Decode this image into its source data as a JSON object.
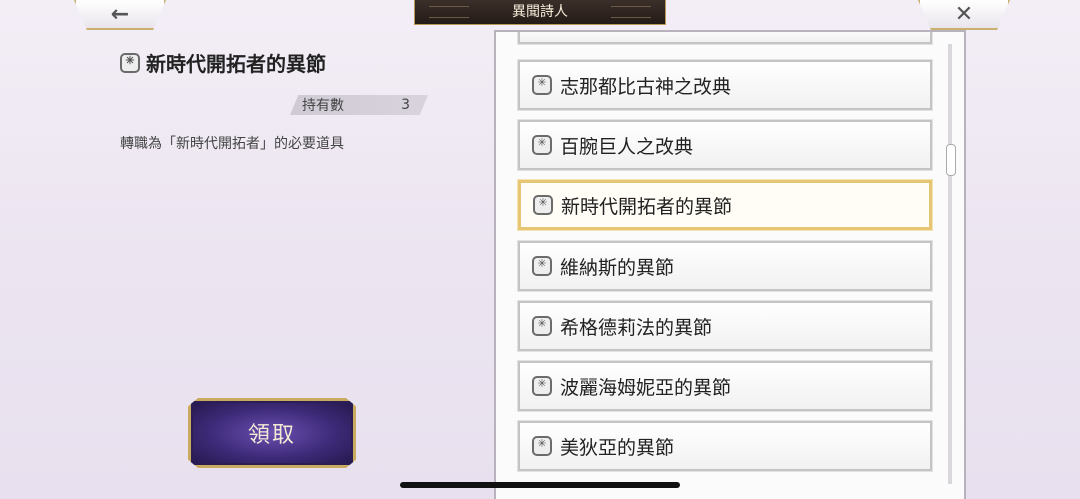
{
  "header": {
    "title": "異聞詩人",
    "back_icon": "←",
    "close_icon": "✕"
  },
  "detail": {
    "item_name": "新時代開拓者的異節",
    "quantity_label": "持有數",
    "quantity_value": "3",
    "description": "轉職為「新時代開拓者」的必要道具"
  },
  "claim_button": {
    "label": "領取"
  },
  "list": {
    "items": [
      {
        "label": "",
        "selected": false
      },
      {
        "label": "志那都比古神之改典",
        "selected": false
      },
      {
        "label": "百腕巨人之改典",
        "selected": false
      },
      {
        "label": "新時代開拓者的異節",
        "selected": true
      },
      {
        "label": "維納斯的異節",
        "selected": false
      },
      {
        "label": "希格德莉法的異節",
        "selected": false
      },
      {
        "label": "波麗海姆妮亞的異節",
        "selected": false
      },
      {
        "label": "美狄亞的異節",
        "selected": false
      }
    ]
  },
  "colors": {
    "accent_gold": "#c9aa5f",
    "selected_border": "#e6c673",
    "button_purple": "#3d2a78"
  }
}
